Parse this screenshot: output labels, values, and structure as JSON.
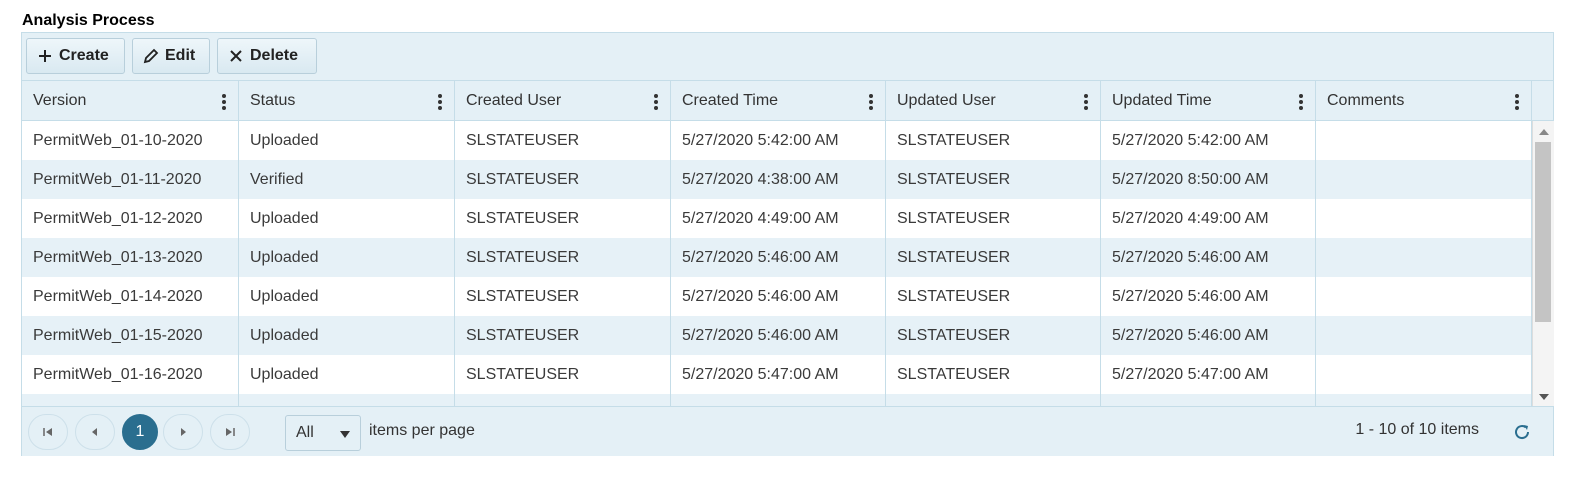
{
  "title": "Analysis Process",
  "toolbar": {
    "create_label": "Create",
    "edit_label": "Edit",
    "delete_label": "Delete"
  },
  "columns": [
    "Version",
    "Status",
    "Created User",
    "Created Time",
    "Updated User",
    "Updated Time",
    "Comments"
  ],
  "rows": [
    [
      "PermitWeb_01-10-2020",
      "Uploaded",
      "SLSTATEUSER",
      "5/27/2020 5:42:00 AM",
      "SLSTATEUSER",
      "5/27/2020 5:42:00 AM",
      ""
    ],
    [
      "PermitWeb_01-11-2020",
      "Verified",
      "SLSTATEUSER",
      "5/27/2020 4:38:00 AM",
      "SLSTATEUSER",
      "5/27/2020 8:50:00 AM",
      ""
    ],
    [
      "PermitWeb_01-12-2020",
      "Uploaded",
      "SLSTATEUSER",
      "5/27/2020 4:49:00 AM",
      "SLSTATEUSER",
      "5/27/2020 4:49:00 AM",
      ""
    ],
    [
      "PermitWeb_01-13-2020",
      "Uploaded",
      "SLSTATEUSER",
      "5/27/2020 5:46:00 AM",
      "SLSTATEUSER",
      "5/27/2020 5:46:00 AM",
      ""
    ],
    [
      "PermitWeb_01-14-2020",
      "Uploaded",
      "SLSTATEUSER",
      "5/27/2020 5:46:00 AM",
      "SLSTATEUSER",
      "5/27/2020 5:46:00 AM",
      ""
    ],
    [
      "PermitWeb_01-15-2020",
      "Uploaded",
      "SLSTATEUSER",
      "5/27/2020 5:46:00 AM",
      "SLSTATEUSER",
      "5/27/2020 5:46:00 AM",
      ""
    ],
    [
      "PermitWeb_01-16-2020",
      "Uploaded",
      "SLSTATEUSER",
      "5/27/2020 5:47:00 AM",
      "SLSTATEUSER",
      "5/27/2020 5:47:00 AM",
      ""
    ]
  ],
  "pager": {
    "current_page": "1",
    "page_size": "All",
    "items_per_page_label": "items per page",
    "info": "1 - 10 of 10 items"
  },
  "colors": {
    "accent": "#2a6e8f",
    "header_bg": "#e4f0f6",
    "alt_row_bg": "#e6f1f7",
    "border": "#c5dde8"
  },
  "icons": {
    "create": "plus-icon",
    "edit": "pencil-icon",
    "delete": "close-icon",
    "column_menu": "kebab-menu-icon",
    "first": "first-page-icon",
    "prev": "previous-page-icon",
    "next": "next-page-icon",
    "last": "last-page-icon",
    "refresh": "refresh-icon"
  }
}
